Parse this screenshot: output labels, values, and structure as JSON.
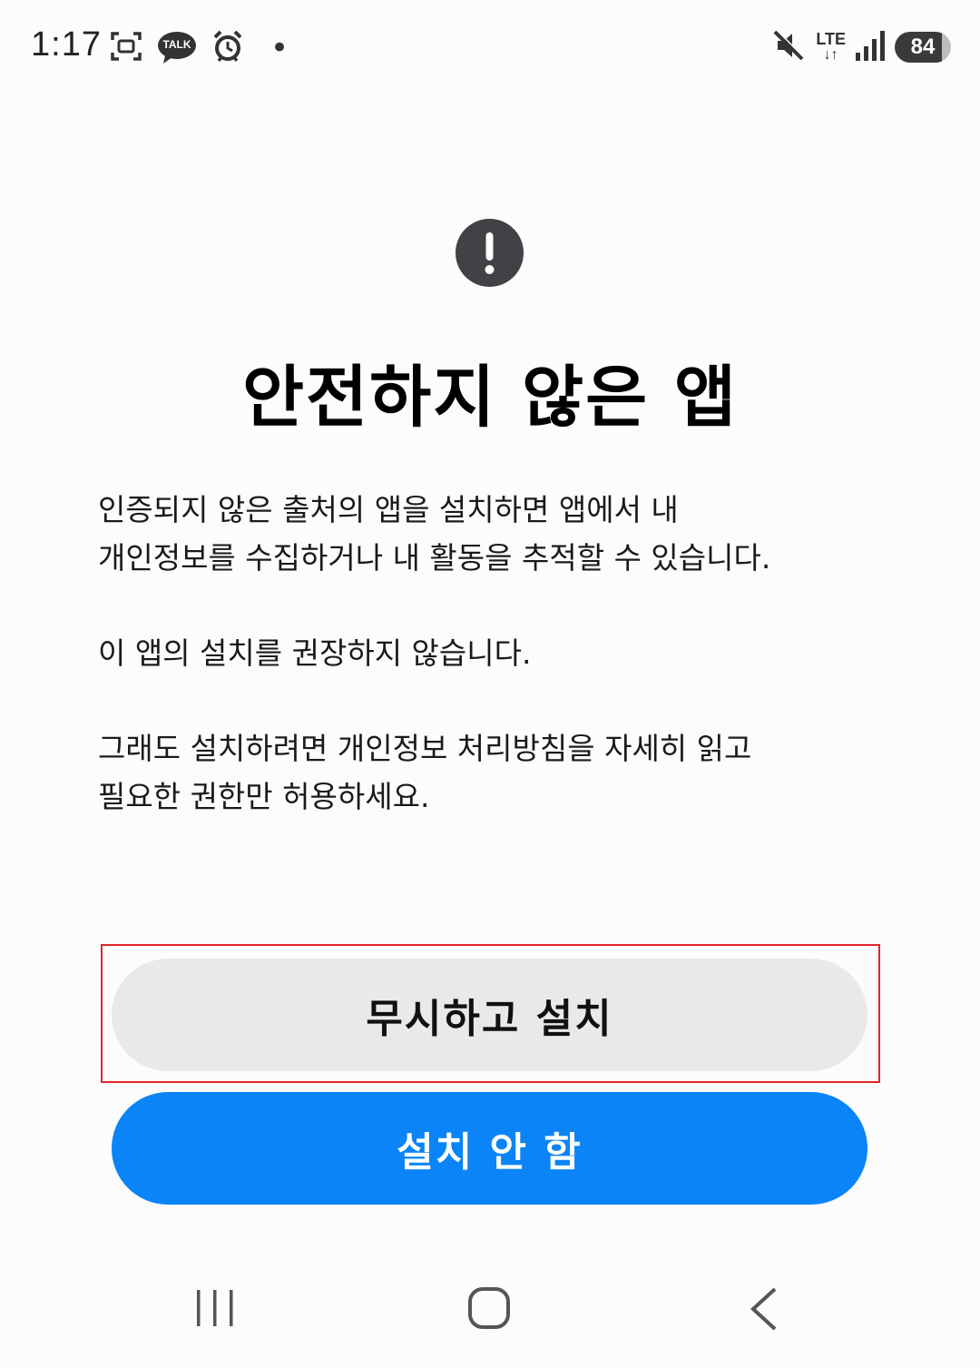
{
  "status_bar": {
    "time": "1:17",
    "talk_label": "TALK",
    "network": "LTE",
    "battery": "84",
    "dot": "•"
  },
  "dialog": {
    "icon": "warning-icon",
    "title": "안전하지 않은 앱",
    "paragraphs": [
      [
        "인증되지 않은 출처의 앱을 설치하면 앱에서 내",
        "개인정보를 수집하거나 내 활동을 추적할 수 있습니다."
      ],
      [
        "이 앱의 설치를 권장하지 않습니다."
      ],
      [
        "그래도 설치하려면 개인정보 처리방침을 자세히 읽고",
        "필요한 권한만 허용하세요."
      ]
    ]
  },
  "buttons": {
    "ignore_install": "무시하고 설치",
    "do_not_install": "설치 안 함"
  },
  "nav_bar": {
    "recents": "recents-icon",
    "home": "home-icon",
    "back": "back-icon"
  },
  "colors": {
    "primary": "#0a84f6",
    "secondary_button": "#e9e9e9",
    "highlight": "#e0262a",
    "icon": "#424246"
  }
}
